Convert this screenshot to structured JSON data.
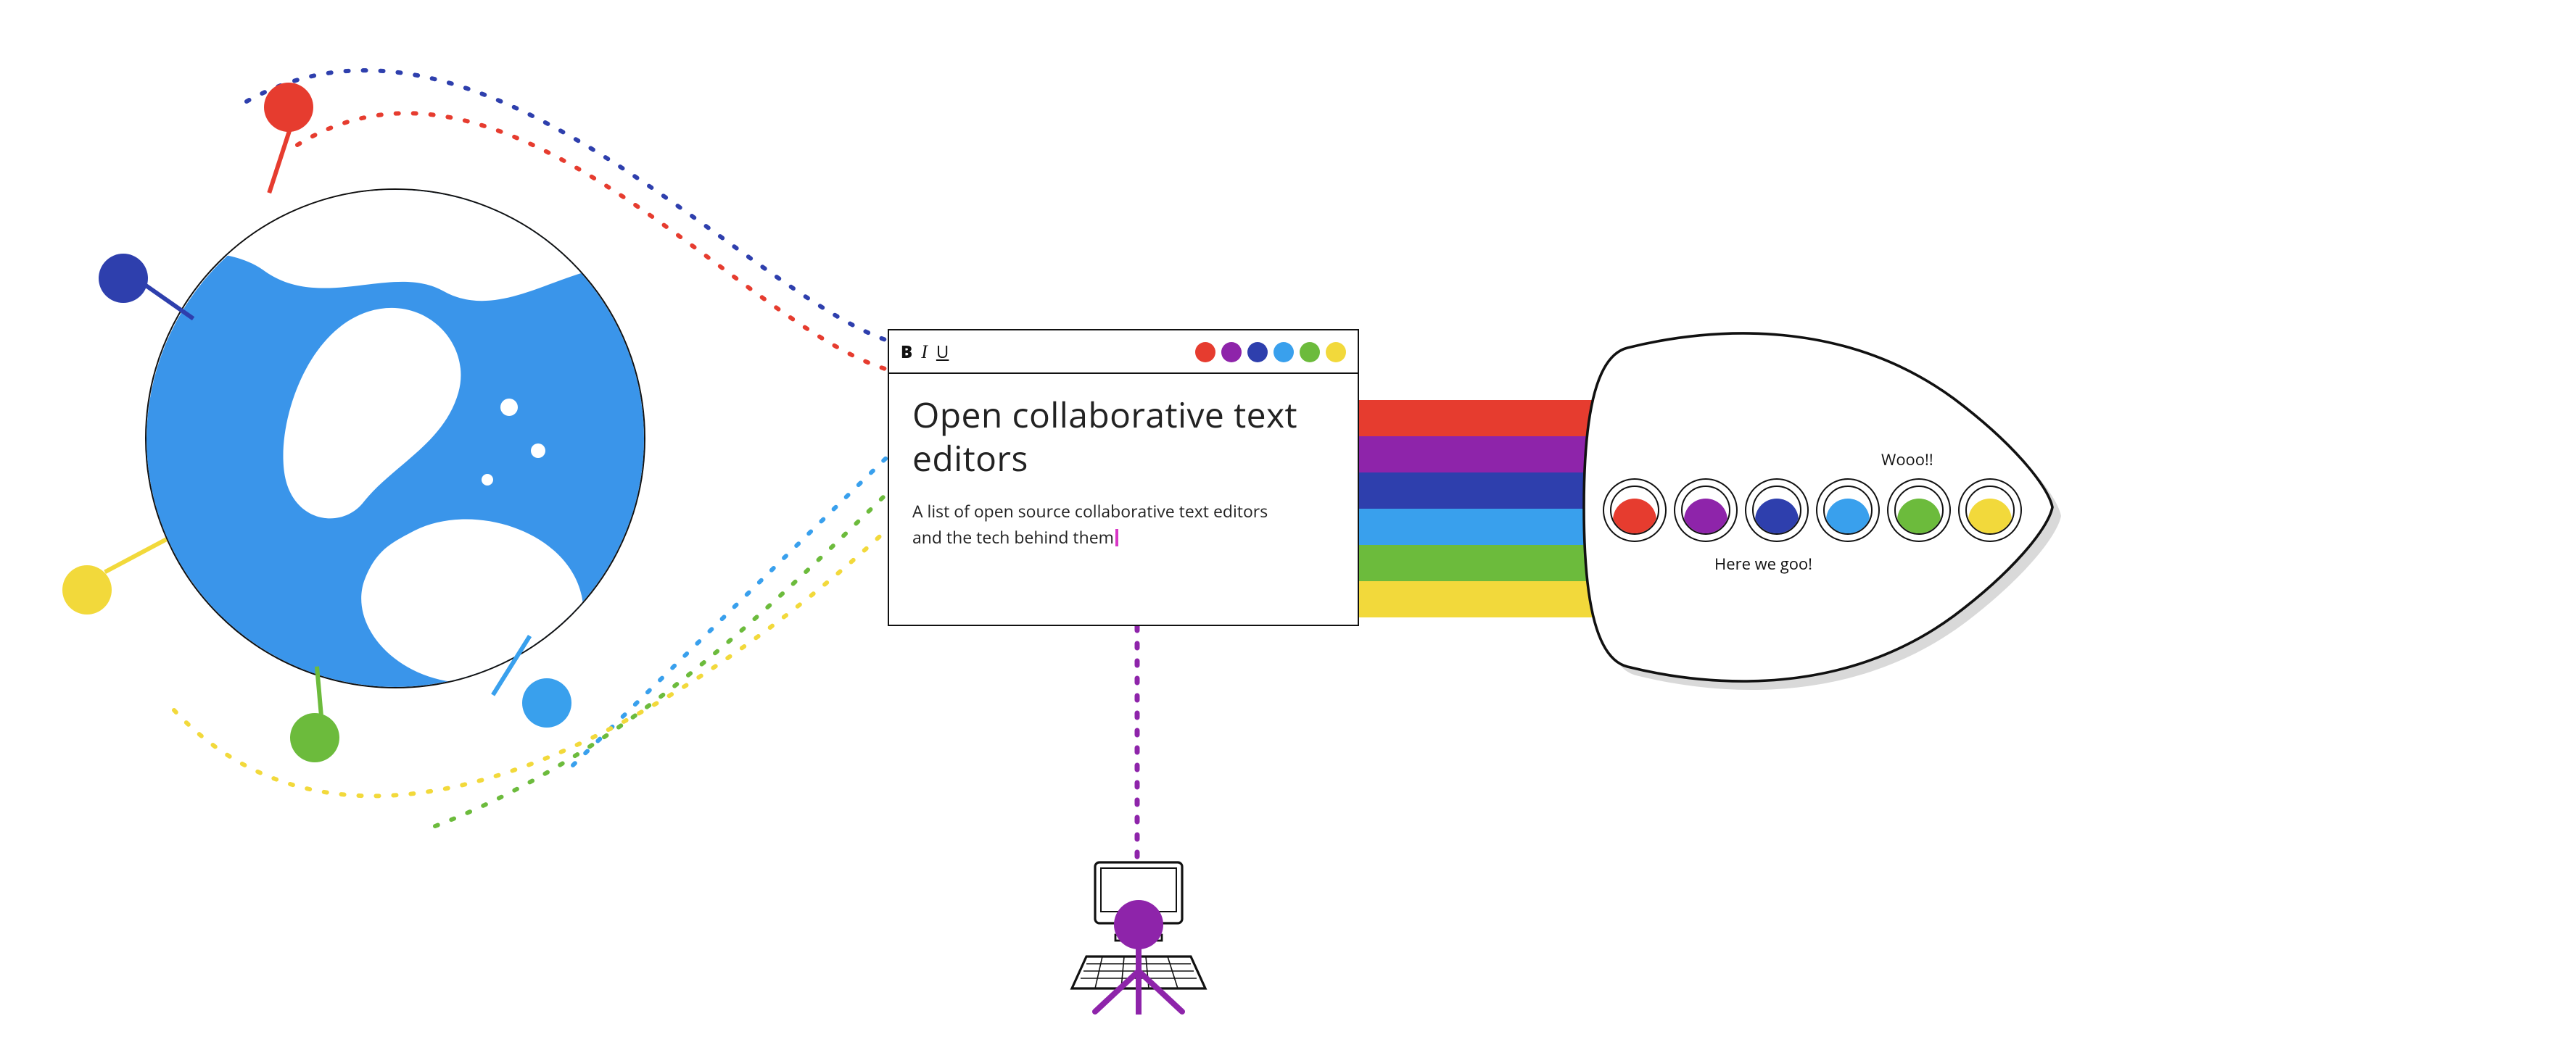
{
  "colors": {
    "red": "#e63c2f",
    "purple": "#8e24aa",
    "blue": "#2e3fad",
    "sky": "#39a0ed",
    "green": "#6cbb3c",
    "yellow": "#f2d93b",
    "globe": "#3a95ea",
    "ink": "#111111",
    "shadow": "#bfbfbf",
    "caret": "#d837c6"
  },
  "editor": {
    "format": {
      "bold": "B",
      "italic": "I",
      "underline": "U"
    },
    "title": "Open collaborative text editors",
    "description": "A list of open source collaborative text editors and the tech behind them",
    "titlebar_dots": [
      "red",
      "purple",
      "blue",
      "sky",
      "green",
      "yellow"
    ]
  },
  "ship": {
    "speech_top": "Wooo!!",
    "speech_bottom": "Here we goo!",
    "portholes": [
      "red",
      "purple",
      "blue",
      "sky",
      "green",
      "yellow"
    ]
  },
  "rainbow_order": [
    "red",
    "purple",
    "blue",
    "sky",
    "green",
    "yellow"
  ],
  "globe": {
    "pins": [
      {
        "id": "pin-red",
        "color": "red"
      },
      {
        "id": "pin-blue",
        "color": "blue"
      },
      {
        "id": "pin-yellow",
        "color": "yellow"
      },
      {
        "id": "pin-green",
        "color": "green"
      },
      {
        "id": "pin-sky",
        "color": "sky"
      }
    ]
  },
  "computer": {
    "user_color": "purple"
  }
}
